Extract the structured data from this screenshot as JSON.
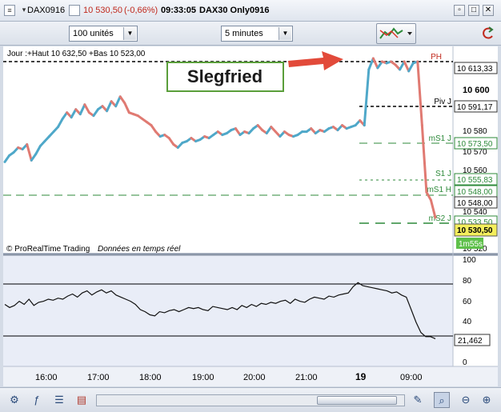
{
  "titlebar": {
    "instrument": "DAX0916",
    "price": "10 530,50",
    "change": "(-0,66%)",
    "time": "09:33:05",
    "description": "DAX30 Only0916",
    "controls": [
      "restore-icon",
      "maximize-icon",
      "close-icon"
    ]
  },
  "toolbar": {
    "quantity": "100 unités",
    "interval": "5 minutes"
  },
  "chart": {
    "header": "Jour :+Haut 10 632,50 +Bas 10 523,00",
    "watermark_brand": "© ProRealTime Trading",
    "watermark_feed": "Données en temps réel",
    "annotation": "Slegfried",
    "annotation_color": "#1a1a1a",
    "annotation_border": "#5a9e3a",
    "arrow_color": "#e24a3a",
    "up_color": "#4fa8c9",
    "down_color": "#e07a72",
    "timer": "1m55s"
  },
  "levels": [
    {
      "label": "PH",
      "value": "10 613,50",
      "style": "black-dash"
    },
    {
      "label": "",
      "value": "10 613,33",
      "style": "marker"
    },
    {
      "label": "Piv J",
      "value": "10 591,17",
      "style": "black-dash"
    },
    {
      "label": "mS1 J",
      "value": "10 573,50",
      "style": "green-dash"
    },
    {
      "label": "S1 J",
      "value": "10 555,83",
      "style": "green-dot"
    },
    {
      "label": "mS1 H",
      "value": "10 548,00",
      "style": "green-dash-long"
    },
    {
      "label": "mS2 J",
      "value": "10 533,50",
      "style": "green-dash"
    }
  ],
  "price_axis": {
    "ticks": [
      "10 600",
      "10 580",
      "10 570",
      "10 560",
      "10 540",
      "10 520"
    ],
    "boxed": [
      "10 613,33",
      "10 591,17",
      "10 573,50",
      "10 555,83",
      "10 548,00",
      "10 533,50"
    ],
    "tick_10546": "10 548,00",
    "current": "10 530,50"
  },
  "indicator": {
    "ticks": [
      "100",
      "80",
      "60",
      "40",
      "20",
      "0"
    ],
    "current": "21,462",
    "upper_line": 75,
    "lower_line": 25
  },
  "time_axis": [
    "16:00",
    "17:00",
    "18:00",
    "19:00",
    "20:00",
    "21:00",
    "19",
    "09:00"
  ],
  "chart_data": {
    "type": "line",
    "price_range": [
      10520,
      10632.5
    ],
    "series": [
      {
        "name": "",
        "values": [
          10567,
          10571,
          10573,
          10576,
          10575,
          10578,
          10568,
          10572,
          10577,
          10580,
          10583,
          10586,
          10589,
          10594,
          10598,
          10595,
          10600,
          10597,
          10603,
          10598,
          10596,
          10600,
          10602,
          10599,
          10605,
          10602,
          10608,
          10604,
          10598,
          10597,
          10596,
          10594,
          10592,
          10590,
          10586,
          10583,
          10584,
          10582,
          10578,
          10576,
          10579,
          10580,
          10582,
          10580,
          10581,
          10583,
          10582,
          10584,
          10586,
          10584,
          10585,
          10587,
          10588,
          10584,
          10586,
          10585,
          10588,
          10590,
          10587,
          10585,
          10589,
          10586,
          10583,
          10586,
          10584,
          10583,
          10584,
          10586,
          10586,
          10588,
          10585,
          10587,
          10586,
          10588,
          10589,
          10587,
          10590,
          10588,
          10589,
          10590,
          10593,
          10590,
          10625,
          10632,
          10626,
          10630,
          10629,
          10630,
          10628,
          10625,
          10630,
          10624,
          10629,
          10630,
          10590,
          10548,
          10543,
          10532
        ]
      }
    ],
    "oscillator": [
      55,
      52,
      54,
      58,
      55,
      60,
      54,
      57,
      58,
      60,
      59,
      61,
      60,
      63,
      65,
      62,
      66,
      68,
      64,
      67,
      69,
      66,
      68,
      64,
      62,
      60,
      58,
      55,
      50,
      48,
      45,
      44,
      48,
      47,
      49,
      50,
      48,
      50,
      52,
      51,
      52,
      50,
      49,
      53,
      52,
      51,
      50,
      52,
      50,
      54,
      52,
      55,
      53,
      56,
      55,
      57,
      56,
      58,
      59,
      56,
      60,
      58,
      57,
      60,
      62,
      61,
      60,
      63,
      62,
      64,
      65,
      66,
      72,
      76,
      73,
      72,
      71,
      70,
      69,
      68,
      66,
      67,
      64,
      62,
      50,
      38,
      28,
      24,
      24,
      22
    ]
  }
}
